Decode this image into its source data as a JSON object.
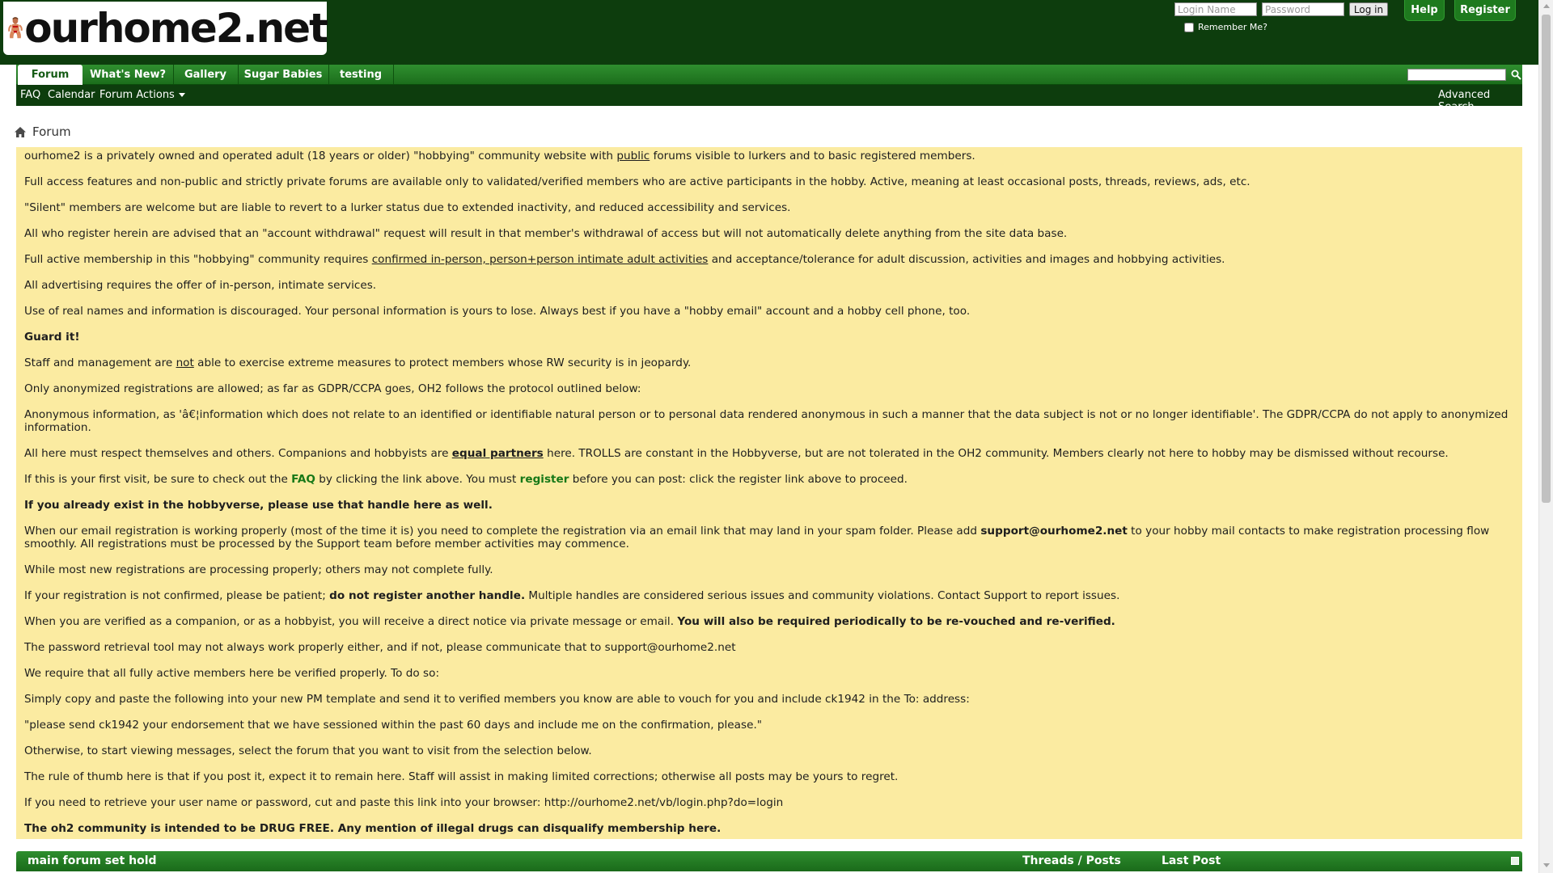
{
  "header": {
    "logo_text": "ourhome2.net",
    "login_name_placeholder": "Login Name",
    "password_placeholder": "Password",
    "login_button": "Log in",
    "remember_me": "Remember Me?",
    "help_button": "Help",
    "register_button": "Register"
  },
  "navbar": {
    "tabs": [
      {
        "label": "Forum"
      },
      {
        "label": "What's New?"
      },
      {
        "label": "Gallery"
      },
      {
        "label": "Sugar Babies"
      },
      {
        "label": "testing"
      }
    ],
    "subnav": {
      "faq": "FAQ",
      "calendar": "Calendar",
      "forum_actions": "Forum Actions",
      "advanced_search": "Advanced Search"
    }
  },
  "breadcrumb": {
    "current": "Forum"
  },
  "notice": {
    "p1_a": "ourhome2 is a privately owned and operated adult (18 years or older) \"hobbying\" community website with ",
    "p1_link": "public",
    "p1_b": " forums visible to lurkers and to basic registered members.",
    "p2": "Full access features and non-public and strictly private forums are available only to validated/verified members who are active participants in the hobby. Active, meaning at least occasional posts, threads, reviews, ads, etc.",
    "p3": "\"Silent\" members are welcome but are liable to revert to a lurker status due to extended inactivity, and reduced accessibility and services.",
    "p4": "All who register herein are advised that an \"account withdrawal\" request will result in that member's withdrawal of access but will not automatically delete anything from the site data base.",
    "p5_a": "Full active membership in this \"hobbying\" community requires ",
    "p5_link": "confirmed in-person, person+person intimate adult activities",
    "p5_b": " and acceptance/tolerance for adult discussion, activities and images and hobbying activities.",
    "p6": "All advertising requires the offer of in-person, intimate services.",
    "p7": "Use of real names and information is discouraged. Your personal information is yours to lose. Always best if you have a \"hobby email\" account and a hobby cell phone, too.",
    "p8": "Guard it!",
    "p9_a": "Staff and management are ",
    "p9_link": "not",
    "p9_b": " able to exercise extreme measures to protect members whose RW security is in jeopardy.",
    "p10": "Only anonymized registrations are allowed; as far as GDPR/CCPA goes, OH2 follows the protocol outlined below:",
    "p11": "Anonymous information, as 'â€¦information which does not relate to an identified or identifiable natural person or to personal data rendered anonymous in such a manner that the data subject is not or no longer identifiable'. The GDPR/CCPA do not apply to anonymized information.",
    "p12_a": "All here must respect themselves and others. Companions and hobbyists are ",
    "p12_link": "equal partners",
    "p12_b": " here. TROLLS are constant in the Hobbyverse, but are not tolerated in the OH2 community. Members clearly not here to hobby may be dismissed without recourse.",
    "p13_a": "If this is your first visit, be sure to check out the ",
    "p13_faq": "FAQ",
    "p13_b": " by clicking the link above. You must ",
    "p13_register": "register",
    "p13_c": " before you can post: click the register link above to proceed.",
    "p14": "If you already exist in the hobbyverse, please use that handle here as well.",
    "p15_a": "When our email registration is working properly (most of the time it is) you need to complete the registration via an email link that may land in your spam folder. Please add ",
    "p15_email": "support@ourhome2.net",
    "p15_b": " to your hobby mail contacts to make registration processing flow smoothly. All registrations must be processed by the Support team before member activities may commence.",
    "p16": "While most new registrations are processing properly; others may not complete fully.",
    "p17_a": "If your registration is not confirmed, please be patient; ",
    "p17_bold": "do not register another handle.",
    "p17_b": " Multiple handles are considered serious issues and community violations. Contact Support to report issues.",
    "p18_a": "When you are verified as a companion, or as a hobbyist, you will receive a direct notice via private message or email. ",
    "p18_bold": "You will also be required periodically to be re-vouched and re-verified.",
    "p19": "The password retrieval tool may not always work properly either, and if not, please communicate that to support@ourhome2.net",
    "p20": "We require that all fully active members here be verified properly. To do so:",
    "p21": "Simply copy and paste the following into your new PM template and send it to verified members you know are able to vouch for you and include ck1942 in the To: address:",
    "p22": "\"please send ck1942 your endorsement that we have sessioned within the past 60 days and include me on the confirmation, please.\"",
    "p23": "Otherwise, to start viewing messages, select the forum that you want to visit from the selection below.",
    "p24": "The rule of thumb here is that if you post it, expect it to remain here. Staff will assist in making limited corrections; otherwise all posts may be yours to regret.",
    "p25": "If you need to retrieve your user name or password, cut and paste this link into your browser: http://ourhome2.net/vb/login.php?do=login",
    "p26": "The oh2 community is intended to be DRUG FREE. Any mention of illegal drugs can disqualify membership here."
  },
  "forum_header": {
    "title": "main forum set hold",
    "threads_posts": "Threads / Posts",
    "last_post": "Last Post"
  },
  "colors": {
    "header_bg": "#0d3d0d",
    "nav_green": "#1e7a1e",
    "notice_bg": "#fbeba1",
    "link_green": "#177817"
  }
}
